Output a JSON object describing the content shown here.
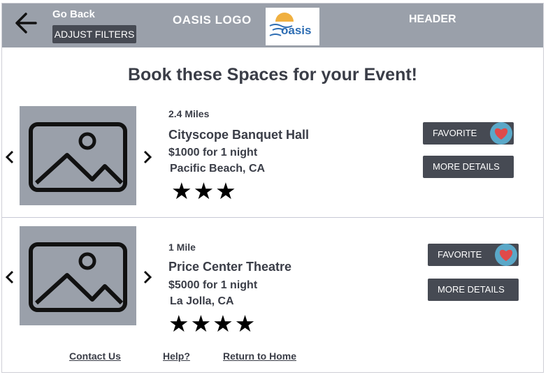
{
  "header": {
    "go_back": "Go Back",
    "adjust_filters": "ADJUST FILTERS",
    "logo_text": "OASIS LOGO",
    "logo_image_text": "oasis",
    "header_label": "HEADER"
  },
  "main": {
    "title": "Book these Spaces for your Event!"
  },
  "listings": [
    {
      "distance": "2.4 Miles",
      "name": "Cityscope Banquet Hall",
      "price": "$1000 for 1 night",
      "location": "Pacific Beach, CA",
      "stars": "★★★",
      "rating": 3,
      "favorite_label": "FAVORITE",
      "details_label": "MORE DETAILS"
    },
    {
      "distance": "1 Mile",
      "name": "Price Center Theatre",
      "price": "$5000 for 1 night",
      "location": "La Jolla, CA",
      "stars": "★★★★",
      "rating": 4,
      "favorite_label": "FAVORITE",
      "details_label": "MORE DETAILS"
    }
  ],
  "footer": {
    "contact": "Contact Us",
    "help": "Help?",
    "home": "Return to Home"
  },
  "colors": {
    "header_bg": "#9aa0aa",
    "button_bg": "#464a53",
    "heart": "#e04a4a",
    "heart_ring": "#5aa8c8"
  }
}
